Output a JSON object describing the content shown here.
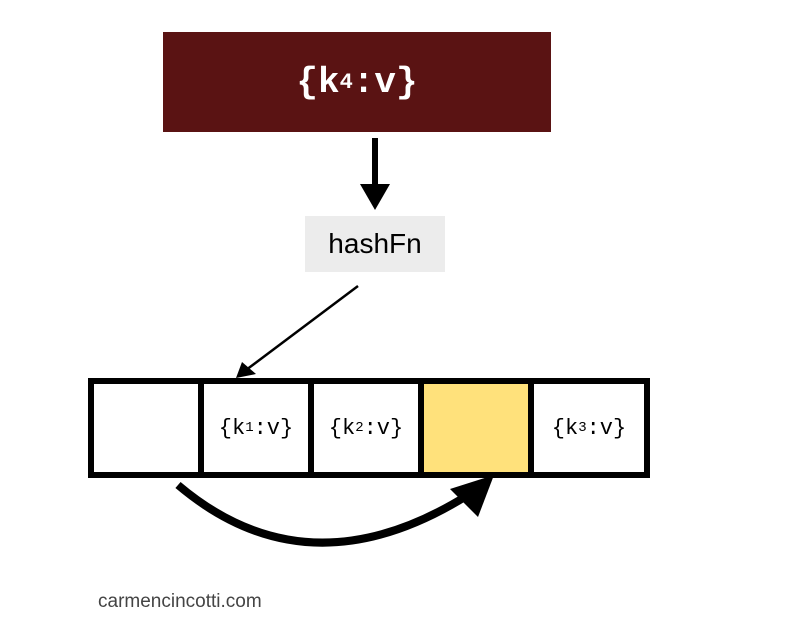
{
  "input": {
    "brace_open": "{ ",
    "key_label": "k",
    "subscript": "4",
    "separator": ": ",
    "value_label": "v",
    "brace_close": " }",
    "bg_color": "#5a1313",
    "fg_color": "#ffffff"
  },
  "hash_fn": {
    "label": "hashFn",
    "bg_color": "#ececec"
  },
  "array": {
    "cells": [
      {
        "brace_open": "",
        "key_label": "",
        "subscript": "",
        "colon": "",
        "value": "",
        "brace_close": "",
        "bg": "#ffffff"
      },
      {
        "brace_open": "{",
        "key_label": "k",
        "subscript": "1",
        "colon": ":",
        "value": "v",
        "brace_close": "}",
        "bg": "#ffffff"
      },
      {
        "brace_open": "{",
        "key_label": "k",
        "subscript": "2",
        "colon": ":",
        "value": "v",
        "brace_close": "}",
        "bg": "#ffffff"
      },
      {
        "brace_open": "",
        "key_label": "",
        "subscript": "",
        "colon": "",
        "value": "",
        "brace_close": "",
        "bg": "#ffe17b"
      },
      {
        "brace_open": "{",
        "key_label": "k",
        "subscript": "3",
        "colon": ":",
        "value": "v",
        "brace_close": "}",
        "bg": "#ffffff"
      }
    ]
  },
  "attribution": "carmencincotti.com"
}
